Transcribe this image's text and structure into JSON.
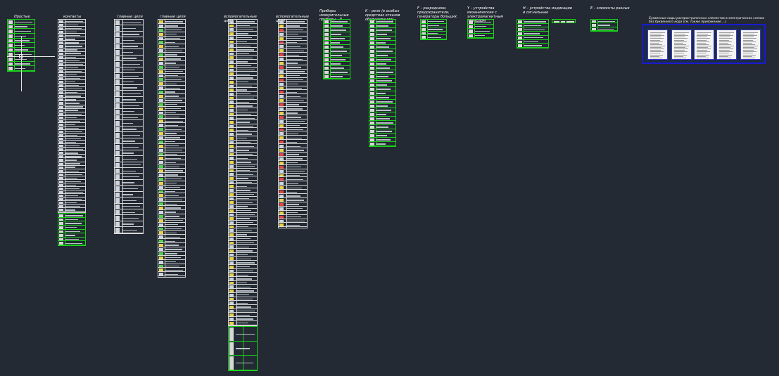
{
  "sections": [
    {
      "id": "prosty",
      "title": "Простые",
      "rows": 11,
      "style": "green",
      "icon_colors": [
        "yellow",
        "green",
        "blue",
        "white"
      ]
    },
    {
      "id": "kontakty",
      "title": "контакты",
      "rows": 54,
      "style": "white",
      "icon_colors": [
        "white"
      ]
    },
    {
      "id": "kontakty-extra",
      "title": "",
      "rows": 8,
      "style": "green",
      "icon_colors": [
        "green",
        "blue",
        "white"
      ]
    },
    {
      "id": "glavnye-tsepi-1",
      "title": "главные цепи",
      "rows": 36,
      "style": "white",
      "icon_colors": [
        "white"
      ]
    },
    {
      "id": "glavnye-tsepi-2",
      "title": "главные цепи",
      "rows": 62,
      "style": "white",
      "icon_colors": [
        "yellow",
        "white",
        "green"
      ]
    },
    {
      "id": "vspomogatelnye-tsepi-1",
      "title": "вспомогательные цепи",
      "rows": 76,
      "style": "white",
      "icon_colors": [
        "white",
        "yellow"
      ]
    },
    {
      "id": "vspomogatelnye-tsepi-1b",
      "title": "",
      "rows": 3,
      "style": "green",
      "icon_colors": [
        "yellow",
        "green"
      ]
    },
    {
      "id": "vspomogatelnye-tsepi-2",
      "title": "вспомогательные цепи",
      "rows": 50,
      "style": "white",
      "icon_colors": [
        "white",
        "yellow",
        "red"
      ]
    },
    {
      "id": "pribory-P",
      "title": "Приборы измерительные приборы – P",
      "rows": 14,
      "style": "green",
      "icon_colors": [
        "green"
      ]
    },
    {
      "id": "K-rele",
      "title": "K – реле (в особых средствах отказов обслуживания)",
      "rows": 30,
      "style": "green",
      "icon_colors": [
        "blue",
        "green"
      ]
    },
    {
      "id": "F-razryadniki",
      "title": "F – разрядники, предохранители, генераторы больших",
      "rows": 5,
      "style": "green",
      "icon_colors": [
        "blue",
        "green"
      ]
    },
    {
      "id": "Y-ustroystva",
      "title": "Y – устройства механические с электромагнитным приводом",
      "rows": 4,
      "style": "green",
      "icon_colors": [
        "green"
      ]
    },
    {
      "id": "H-ustroystva",
      "title": "H – устройства индикации и сигнальные",
      "rows": 7,
      "style": "green",
      "icon_colors": [
        "blue",
        "yellow",
        "green"
      ]
    },
    {
      "id": "E-elementy",
      "title": "E – элементы разные",
      "rows": 3,
      "style": "green",
      "icon_colors": [
        "red",
        "green"
      ]
    }
  ],
  "reference_note": "Буквенные коды распространенных элементов в электрических схемах",
  "reference_note_line2": "без буквенного кода (см. также приложение ...)",
  "reference_pages": 5,
  "colors": {
    "background": "#232a33",
    "table_line": "#d8d8d8",
    "group_line": "#19d219",
    "frame": "#1a1ad0",
    "title": "#ffffff"
  }
}
